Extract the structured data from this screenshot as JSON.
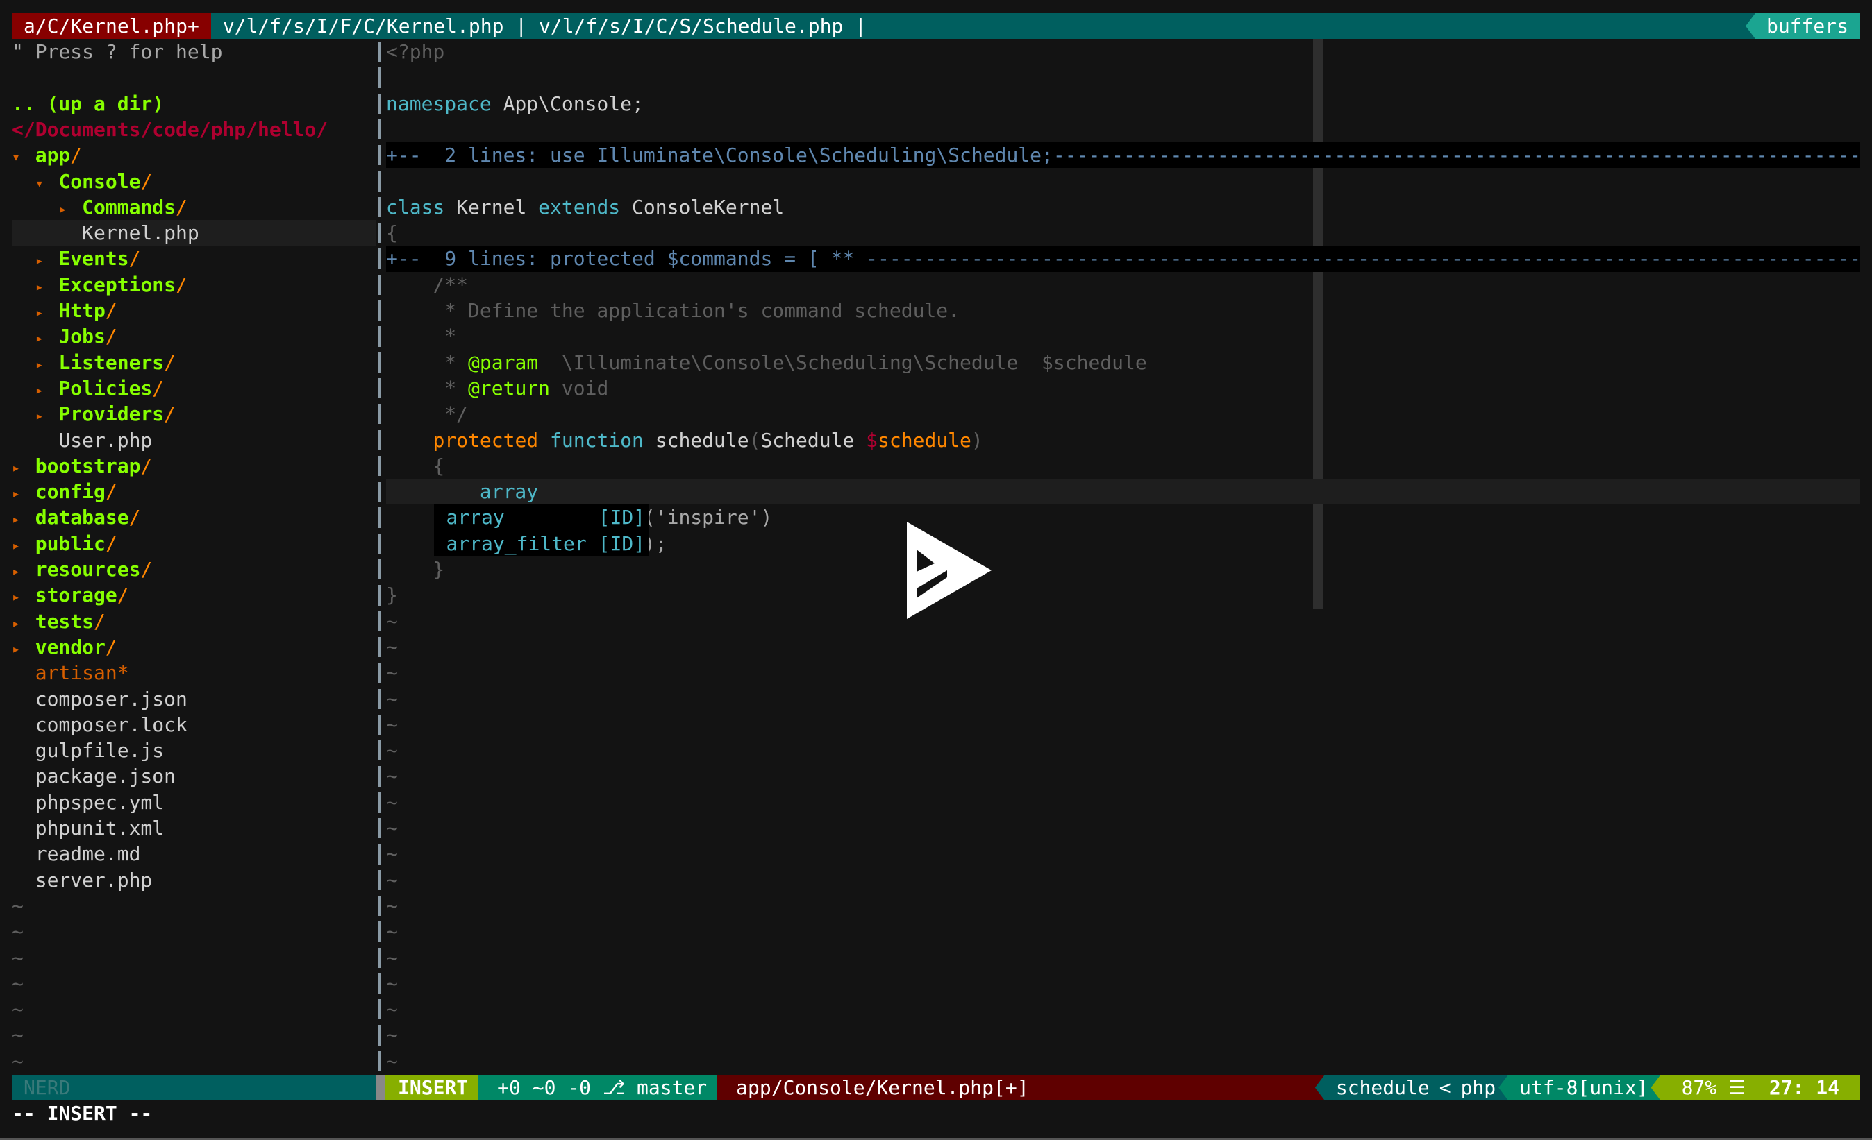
{
  "tabline": {
    "active_tab": "a/C/Kernel.php+",
    "other_tabs": "v/l/f/s/I/F/C/Kernel.php | v/l/f/s/I/C/S/Schedule.php |",
    "buffers_label": "buffers"
  },
  "tree": {
    "help": "\" Press ? for help",
    "up_dir": ".. (up a dir)",
    "root": "</Documents/code/php/hello/",
    "entries": [
      {
        "indent": 0,
        "arrow": "▾",
        "name": "app",
        "dir": true
      },
      {
        "indent": 1,
        "arrow": "▾",
        "name": "Console",
        "dir": true
      },
      {
        "indent": 2,
        "arrow": "▸",
        "name": "Commands",
        "dir": true
      },
      {
        "indent": 2,
        "arrow": "",
        "name": "Kernel.php",
        "dir": false,
        "selected": true
      },
      {
        "indent": 1,
        "arrow": "▸",
        "name": "Events",
        "dir": true
      },
      {
        "indent": 1,
        "arrow": "▸",
        "name": "Exceptions",
        "dir": true
      },
      {
        "indent": 1,
        "arrow": "▸",
        "name": "Http",
        "dir": true
      },
      {
        "indent": 1,
        "arrow": "▸",
        "name": "Jobs",
        "dir": true
      },
      {
        "indent": 1,
        "arrow": "▸",
        "name": "Listeners",
        "dir": true
      },
      {
        "indent": 1,
        "arrow": "▸",
        "name": "Policies",
        "dir": true
      },
      {
        "indent": 1,
        "arrow": "▸",
        "name": "Providers",
        "dir": true
      },
      {
        "indent": 1,
        "arrow": "",
        "name": "User.php",
        "dir": false
      },
      {
        "indent": 0,
        "arrow": "▸",
        "name": "bootstrap",
        "dir": true
      },
      {
        "indent": 0,
        "arrow": "▸",
        "name": "config",
        "dir": true
      },
      {
        "indent": 0,
        "arrow": "▸",
        "name": "database",
        "dir": true
      },
      {
        "indent": 0,
        "arrow": "▸",
        "name": "public",
        "dir": true
      },
      {
        "indent": 0,
        "arrow": "▸",
        "name": "resources",
        "dir": true
      },
      {
        "indent": 0,
        "arrow": "▸",
        "name": "storage",
        "dir": true
      },
      {
        "indent": 0,
        "arrow": "▸",
        "name": "tests",
        "dir": true
      },
      {
        "indent": 0,
        "arrow": "▸",
        "name": "vendor",
        "dir": true
      },
      {
        "indent": 0,
        "arrow": "",
        "name": "artisan*",
        "dir": false,
        "exec": true
      },
      {
        "indent": 0,
        "arrow": "",
        "name": "composer.json",
        "dir": false
      },
      {
        "indent": 0,
        "arrow": "",
        "name": "composer.lock",
        "dir": false
      },
      {
        "indent": 0,
        "arrow": "",
        "name": "gulpfile.js",
        "dir": false
      },
      {
        "indent": 0,
        "arrow": "",
        "name": "package.json",
        "dir": false
      },
      {
        "indent": 0,
        "arrow": "",
        "name": "phpspec.yml",
        "dir": false
      },
      {
        "indent": 0,
        "arrow": "",
        "name": "phpunit.xml",
        "dir": false
      },
      {
        "indent": 0,
        "arrow": "",
        "name": "readme.md",
        "dir": false
      },
      {
        "indent": 0,
        "arrow": "",
        "name": "server.php",
        "dir": false
      }
    ],
    "tilde_count": 7
  },
  "editor": {
    "lines": [
      [
        {
          "t": "<?php",
          "c": "cmt"
        }
      ],
      [],
      [
        {
          "t": "namespace",
          "c": "kw2"
        },
        {
          "t": " App\\Console;",
          "c": ""
        }
      ],
      [],
      [
        {
          "t": "+--  2 lines: use Illuminate\\Console\\Scheduling\\Schedule;",
          "c": "fold",
          "fold": true
        }
      ],
      [],
      [
        {
          "t": "class",
          "c": "kw2"
        },
        {
          "t": " Kernel ",
          "c": ""
        },
        {
          "t": "extends",
          "c": "kw2"
        },
        {
          "t": " ConsoleKernel",
          "c": ""
        }
      ],
      [
        {
          "t": "{",
          "c": "paren"
        }
      ],
      [
        {
          "t": "+--  9 lines: protected $commands = [ ** ",
          "c": "fold",
          "fold": true
        }
      ],
      [
        {
          "t": "    /**",
          "c": "cmt"
        }
      ],
      [
        {
          "t": "     * Define the application's command schedule.",
          "c": "cmt"
        }
      ],
      [
        {
          "t": "     *",
          "c": "cmt"
        }
      ],
      [
        {
          "t": "     * ",
          "c": "cmt"
        },
        {
          "t": "@param",
          "c": "tag"
        },
        {
          "t": "  \\Illuminate\\Console\\Scheduling\\Schedule  $schedule",
          "c": "cmt"
        }
      ],
      [
        {
          "t": "     * ",
          "c": "cmt"
        },
        {
          "t": "@return",
          "c": "tag"
        },
        {
          "t": " void",
          "c": "cmt"
        }
      ],
      [
        {
          "t": "     */",
          "c": "cmt"
        }
      ],
      [
        {
          "t": "    ",
          "c": ""
        },
        {
          "t": "protected",
          "c": "kwo"
        },
        {
          "t": " ",
          "c": ""
        },
        {
          "t": "function",
          "c": "kw2"
        },
        {
          "t": " schedule",
          "c": ""
        },
        {
          "t": "(",
          "c": "paren"
        },
        {
          "t": "Schedule ",
          "c": ""
        },
        {
          "t": "$",
          "c": "var"
        },
        {
          "t": "schedule",
          "c": "kwo"
        },
        {
          "t": ")",
          "c": "paren"
        }
      ],
      [
        {
          "t": "    {",
          "c": "paren"
        }
      ],
      [
        {
          "t": "        array",
          "c": "kw2"
        }
      ],
      [
        {
          "t": "                      ",
          "c": ""
        },
        {
          "t": "('inspire')",
          "c": "str"
        }
      ],
      [
        {
          "t": "                      ",
          "c": ""
        },
        {
          "t": ");",
          "c": "str"
        }
      ],
      [
        {
          "t": "    }",
          "c": "paren"
        }
      ],
      [
        {
          "t": "}",
          "c": "paren"
        }
      ]
    ],
    "cursor_line_index": 17,
    "tilde_count": 18
  },
  "completion_menu": {
    "items": [
      {
        "word": "array",
        "kind": "[ID]"
      },
      {
        "word": "array_filter",
        "kind": "[ID]"
      }
    ]
  },
  "statusline": {
    "nerd_label": "NERD",
    "mode": "INSERT",
    "git": "+0 ~0 -0 ⎇ master",
    "filename": "app/Console/Kernel.php[+]",
    "function": "schedule",
    "filetype": "php",
    "encoding": "utf-8[unix]",
    "percent": "87%",
    "line_col": "27: 14"
  },
  "cmdline": "-- INSERT --",
  "overlay": {
    "icon": "asciinema-play-icon"
  }
}
